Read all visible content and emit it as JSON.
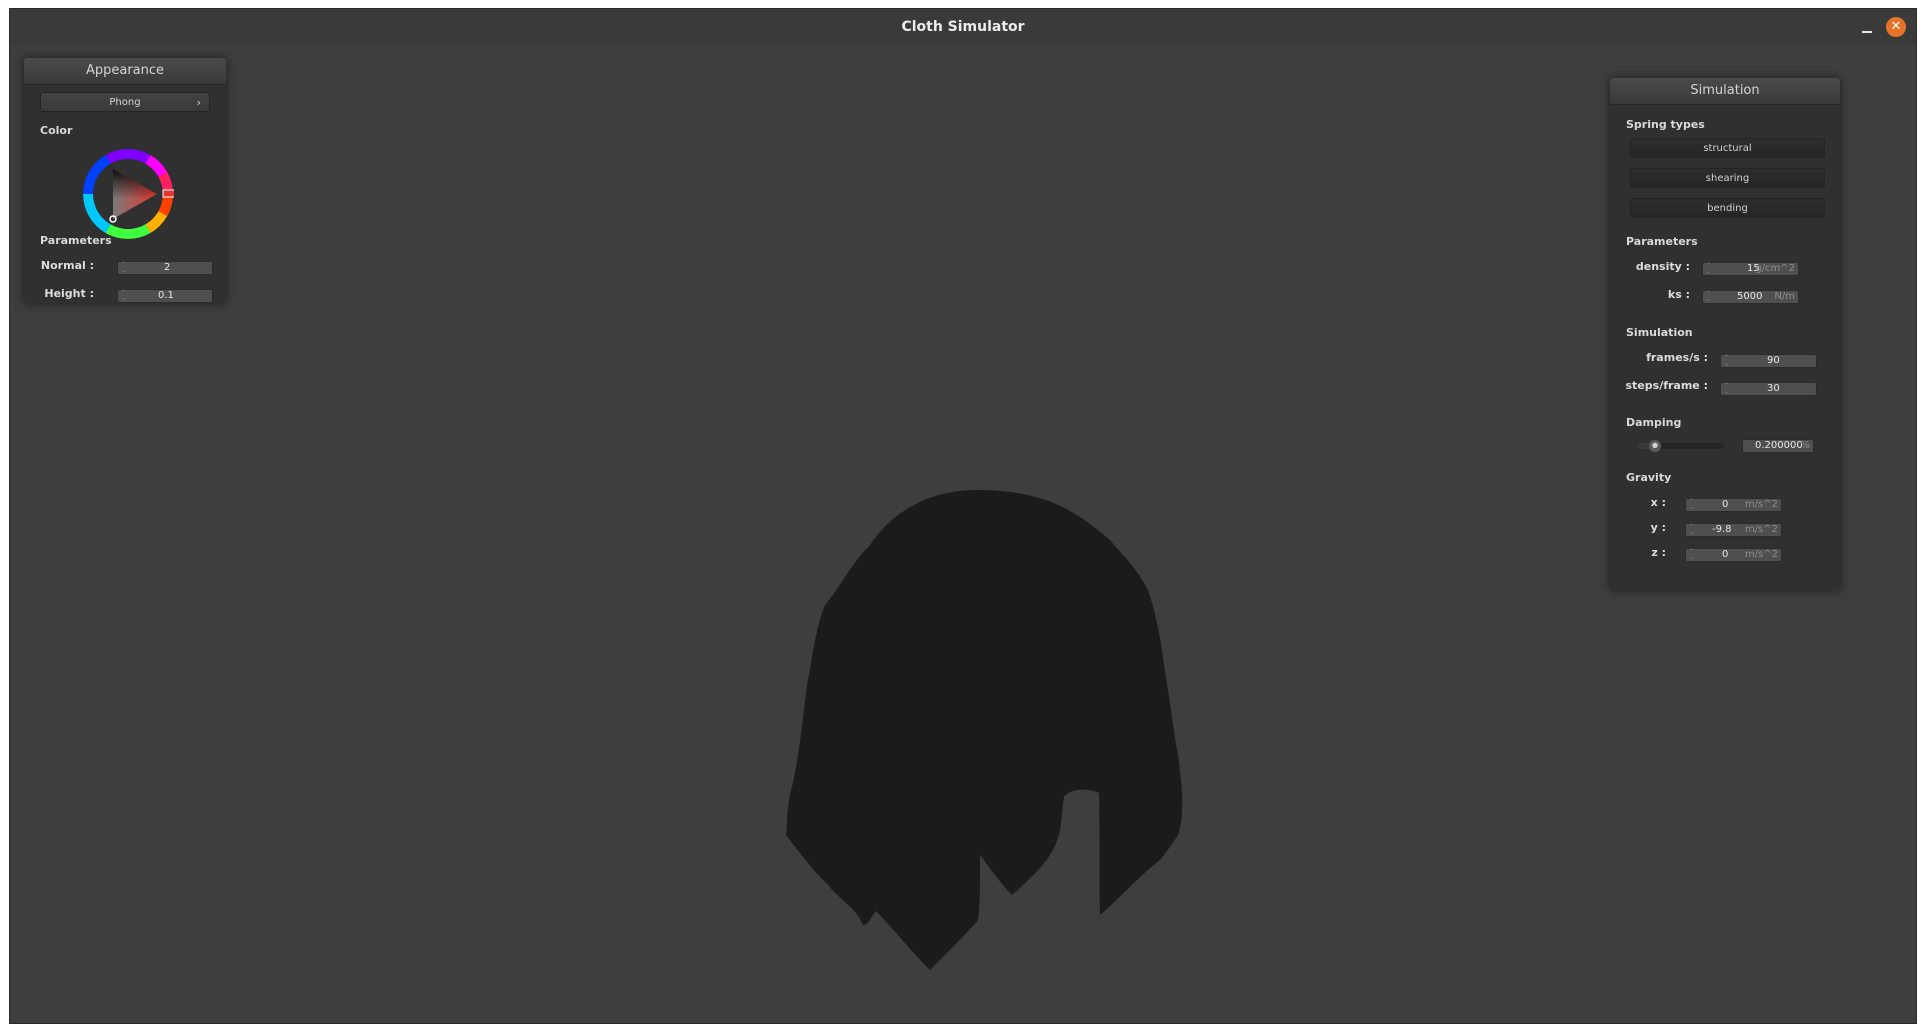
{
  "window": {
    "title": "Cloth Simulator"
  },
  "appearance": {
    "header": "Appearance",
    "shader_select": "Phong",
    "color_label": "Color",
    "selected_color": "#e5352f",
    "parameters_label": "Parameters",
    "normal_label": "Normal :",
    "normal_value": "2",
    "height_label": "Height :",
    "height_value": "0.1"
  },
  "simulation": {
    "header": "Simulation",
    "spring_types_label": "Spring types",
    "spring_buttons": [
      "structural",
      "shearing",
      "bending"
    ],
    "parameters_label": "Parameters",
    "density_label": "density :",
    "density_value": "15",
    "density_unit": "g/cm^2",
    "ks_label": "ks :",
    "ks_value": "5000",
    "ks_unit": "N/m",
    "simulation_label": "Simulation",
    "fps_label": "frames/s :",
    "fps_value": "90",
    "steps_label": "steps/frame :",
    "steps_value": "30",
    "damping_label": "Damping",
    "damping_value": "0.200000",
    "damping_unit": "%",
    "damping_level": 0.2,
    "gravity_label": "Gravity",
    "gx_label": "x :",
    "gx_value": "0",
    "gy_label": "y :",
    "gy_value": "-9.8",
    "gz_label": "z :",
    "gz_value": "0",
    "gravity_unit": "m/s^2"
  },
  "colors": {
    "background": "#3e3e3e",
    "panel": "#303030",
    "cloth": "#1b1b1b",
    "close_button": "#e7732a"
  },
  "icons": {
    "close": "close-icon",
    "minimize": "minimize-icon",
    "chevron": "chevron-right-icon",
    "spinner": "spinner-arrows-icon"
  }
}
